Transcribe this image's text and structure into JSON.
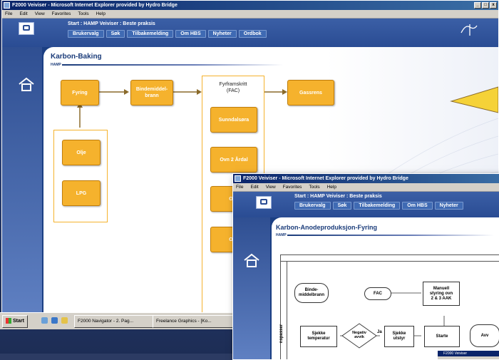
{
  "colors": {
    "accent": "#f5b22d",
    "title_bar": "#0a246a",
    "site_blue": "#1b3f83"
  },
  "back_window": {
    "title": "F2000 Veiviser - Microsoft Internet Explorer provided by Hydro Bridge",
    "menu": [
      "File",
      "Edit",
      "View",
      "Favorites",
      "Tools",
      "Help"
    ],
    "start_line": "Start : HAMP Veiviser : Beste praksis",
    "nav": [
      "Brukervalg",
      "Søk",
      "Tilbakemelding",
      "Om HBS",
      "Nyheter",
      "Ordbok"
    ],
    "page_title": "Karbon-Baking",
    "hamp_label": "HAMP",
    "flow": {
      "fyring": "Fyring",
      "bindemiddel": "Bindemiddel-\nbrann",
      "fyrframskritt": "Fyrframskritt\n(FAC)",
      "gassrens": "Gassrens",
      "olje": "Olje",
      "lpg": "LPG",
      "sunndalsora": "Sunndalsøra",
      "ovn2ardal": "Ovn 2 Årdal",
      "ovn_a": "Ovn",
      "ovn_b": "Ovn"
    }
  },
  "front_window": {
    "title": "F2000 Veiviser - Microsoft Internet Explorer provided by Hydro Bridge",
    "menu": [
      "File",
      "Edit",
      "View",
      "Favorites",
      "Tools",
      "Help"
    ],
    "start_line": "Start : HAMP Veiviser : Beste praksis",
    "nav": [
      "Brukervalg",
      "Søk",
      "Tilbakemelding",
      "Om HBS",
      "Nyheter"
    ],
    "page_title": "Karbon-Anodeproduksjon-Fyring",
    "hamp_label": "HAMP",
    "side_label": "nspasser",
    "flow": {
      "binde": "Binde-\nmiddelbrann",
      "fac": "FAC",
      "manuell": "Manuell\nstyring ovn\n2 & 3 AAK",
      "sjekke_temp": "Sjekke\ntemperatur",
      "negativ": "Negativ\navvik",
      "ja": "Ja",
      "sjekke_utstyr": "Sjekke\nutstyr",
      "starte": "Starte",
      "avv": "Avv"
    },
    "mini_window_title": "F2000 Veiviser"
  },
  "taskbar": {
    "start": "Start",
    "items": [
      "F2000 Navigator - 2. Pag...",
      "Freelance Graphics - [Ko..."
    ]
  }
}
